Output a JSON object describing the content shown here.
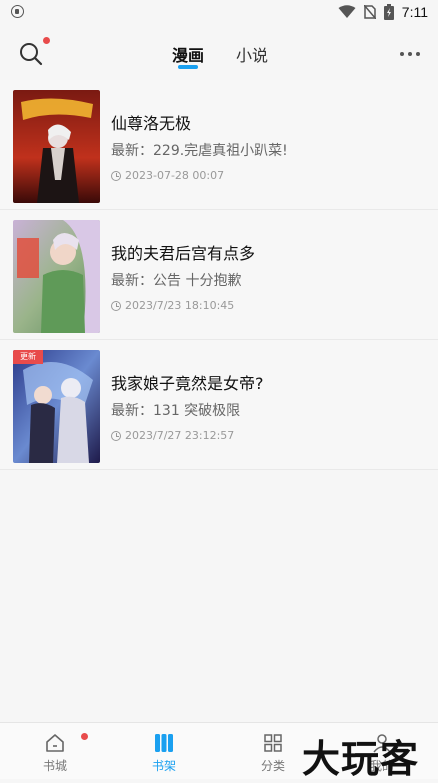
{
  "status_bar": {
    "time": "7:11"
  },
  "header": {
    "tabs": [
      {
        "label": "漫画",
        "active": true
      },
      {
        "label": "小说",
        "active": false
      }
    ]
  },
  "shelf": {
    "items": [
      {
        "title": "仙尊洛无极",
        "latest": "最新：229.完虐真祖小趴菜!",
        "time": "2023-07-28 00:07",
        "badge": ""
      },
      {
        "title": "我的夫君后宫有点多",
        "latest": "最新：公告 十分抱歉",
        "time": "2023/7/23 18:10:45",
        "badge": ""
      },
      {
        "title": "我家娘子竟然是女帝?",
        "latest": "最新：131 突破极限",
        "time": "2023/7/27 23:12:57",
        "badge": "更新"
      }
    ]
  },
  "bottom_nav": [
    {
      "label": "书城",
      "icon": "home-icon",
      "active": false
    },
    {
      "label": "书架",
      "icon": "bookshelf-icon",
      "active": true
    },
    {
      "label": "分类",
      "icon": "grid-icon",
      "active": false
    },
    {
      "label": "我的",
      "icon": "user-icon",
      "active": false
    }
  ],
  "watermark": {
    "text": "大玩客"
  },
  "colors": {
    "accent": "#1aa0f0",
    "notify_dot": "#e84b4b"
  }
}
